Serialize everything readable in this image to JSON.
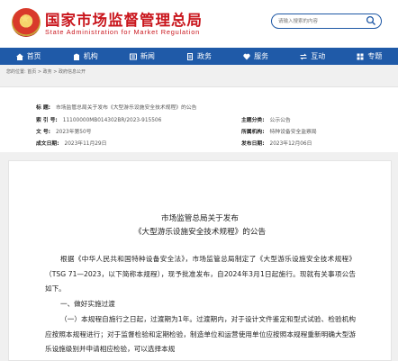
{
  "header": {
    "title": "国家市场监督管理总局",
    "subtitle": "State Administration for Market Regulation",
    "search_placeholder": "请输入搜索的内容"
  },
  "nav": [
    {
      "label": "首页",
      "icon": "home-icon"
    },
    {
      "label": "机构",
      "icon": "building-icon"
    },
    {
      "label": "新闻",
      "icon": "news-icon"
    },
    {
      "label": "政务",
      "icon": "document-icon"
    },
    {
      "label": "服务",
      "icon": "heart-icon"
    },
    {
      "label": "互动",
      "icon": "exchange-icon"
    },
    {
      "label": "专题",
      "icon": "topic-icon"
    }
  ],
  "breadcrumb": "您的位置: 首页 > 政务 > 政府信息公开",
  "meta": {
    "title_key": "标      题:",
    "title_value": "市场监管总局关于发布《大型游乐设施安全技术规程》的公告",
    "index_key": "索 引 号:",
    "index_value": "11100000MB014302BR/2023-915506",
    "category_key": "主题分类:",
    "category_value": "公示公告",
    "doc_key": "文      号:",
    "doc_value": "2023年第50号",
    "org_key": "所属机构:",
    "org_value": "特种设备安全监察局",
    "created_key": "成文日期:",
    "created_value": "2023年11月29日",
    "published_key": "发布日期:",
    "published_value": "2023年12月06日"
  },
  "article": {
    "title_line1": "市场监管总局关于发布",
    "title_line2": "《大型游乐设施安全技术规程》的公告",
    "paragraph1": "根据《中华人民共和国特种设备安全法》，市场监管总局制定了《大型游乐设施安全技术规程》（TSG 71—2023，以下简称本规程），现予批准发布，自2024年3月1日起施行。现就有关事项公告如下。",
    "paragraph2": "一、做好实施过渡",
    "paragraph3": "（一）本规程自施行之日起，过渡期为1年。过渡期内，对于设计文件鉴定和型式试验、检验机构应按照本规程进行；对于监督检验和定期检验，制造单位和运营使用单位应按照本规程重新明确大型游乐设施级别并申请相应检验，可以选择本规"
  }
}
